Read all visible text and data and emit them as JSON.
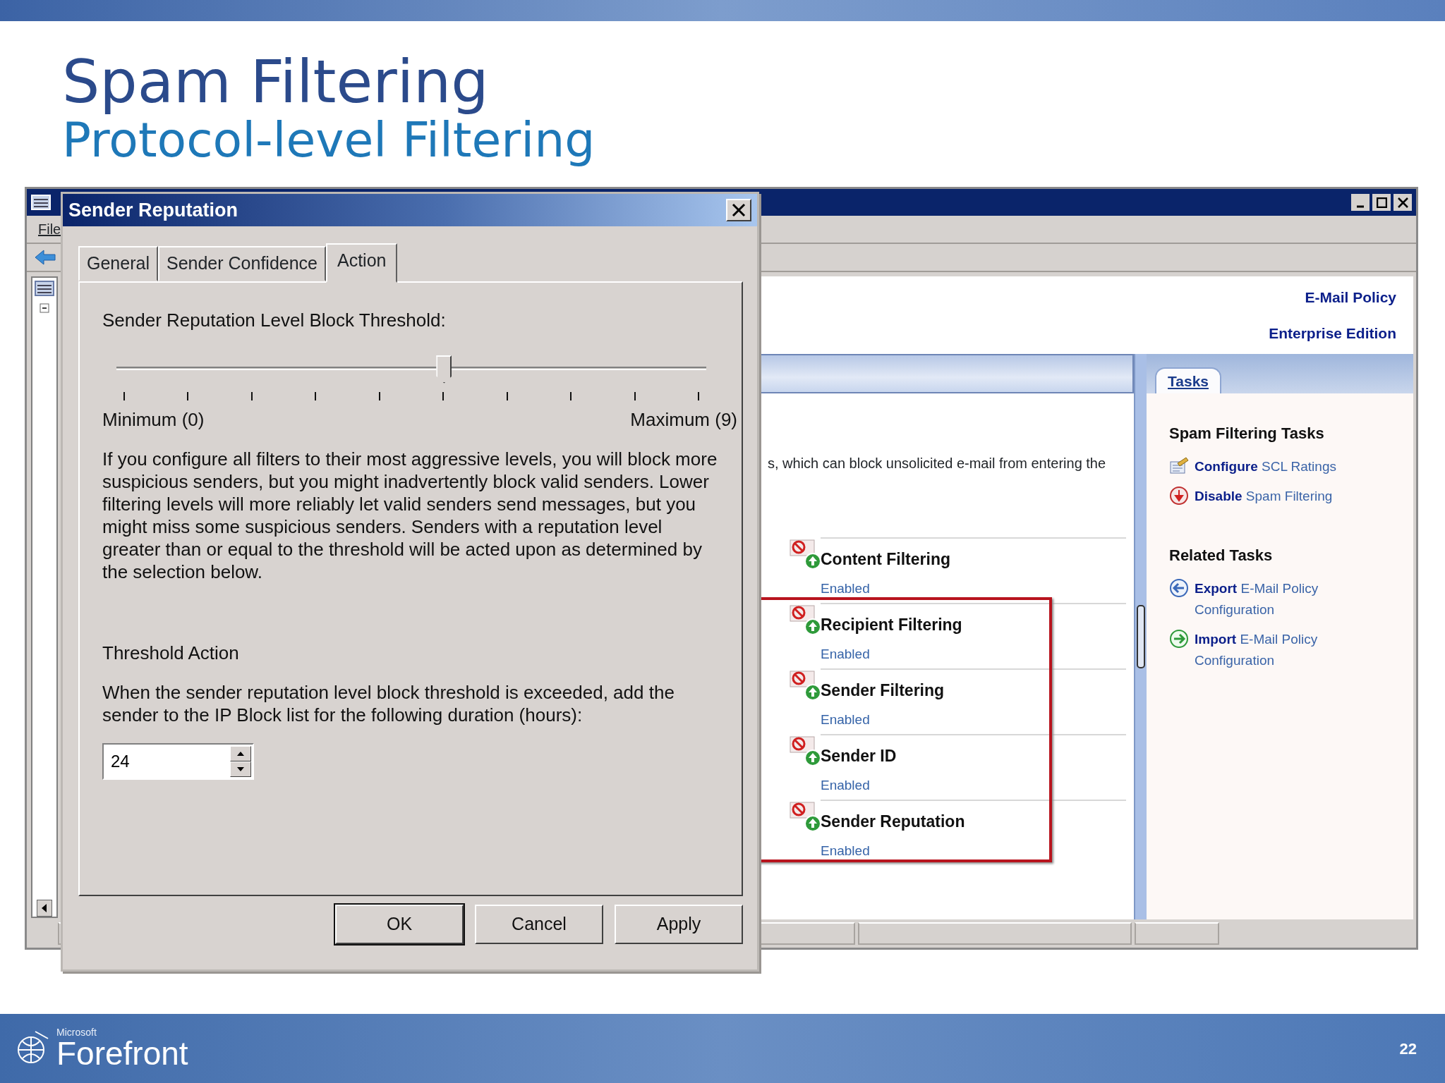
{
  "slide": {
    "title": "Spam Filtering",
    "subtitle": "Protocol-level Filtering",
    "brand_small": "Microsoft",
    "brand": "Forefront",
    "page_number": "22"
  },
  "console": {
    "menu": [
      "File"
    ],
    "header_links": [
      "E-Mail Policy",
      "Enterprise Edition"
    ],
    "description": "s, which can block unsolicited e-mail from entering the",
    "filters": [
      {
        "name": "Content Filtering",
        "status": "Enabled",
        "highlighted": false
      },
      {
        "name": "Recipient Filtering",
        "status": "Enabled",
        "highlighted": true
      },
      {
        "name": "Sender Filtering",
        "status": "Enabled",
        "highlighted": true
      },
      {
        "name": "Sender ID",
        "status": "Enabled",
        "highlighted": true
      },
      {
        "name": "Sender Reputation",
        "status": "Enabled",
        "highlighted": true
      }
    ],
    "tasks_tab": "Tasks",
    "task_sections": [
      {
        "title": "Spam Filtering Tasks",
        "items": [
          {
            "kind": "configure",
            "text": "**Configure** SCL Ratings"
          },
          {
            "kind": "disable",
            "text": "**Disable** Spam Filtering"
          }
        ]
      },
      {
        "title": "Related Tasks",
        "items": [
          {
            "kind": "export",
            "text": "**Export** E-Mail Policy Configuration"
          },
          {
            "kind": "import",
            "text": "**Import** E-Mail Policy Configuration"
          }
        ]
      }
    ]
  },
  "dialog": {
    "title": "Sender Reputation",
    "tabs": [
      {
        "label": "General",
        "selected": false
      },
      {
        "label": "Sender Confidence",
        "selected": false
      },
      {
        "label": "Action",
        "selected": true
      }
    ],
    "threshold_label": "Sender Reputation Level Block Threshold:",
    "slider": {
      "level": 0.5556,
      "min_label": "Minimum (0)",
      "max_label": "Maximum (9)"
    },
    "explanation": "If you configure all filters to their most aggressive levels, you will block more suspicious senders, but you might inadvertently block valid senders. Lower filtering levels will more reliably let valid senders send messages, but you might miss some suspicious senders. Senders with a reputation level greater than or equal to the threshold will be acted upon as determined by the selection below.",
    "action_heading": "Threshold Action",
    "action_text": "When the sender reputation level block threshold is exceeded, add the sender to the IP Block list for the following duration (hours):",
    "duration": "24",
    "buttons": [
      {
        "label": "OK",
        "default": true
      },
      {
        "label": "Cancel",
        "default": false
      },
      {
        "label": "Apply",
        "default": false
      }
    ]
  }
}
